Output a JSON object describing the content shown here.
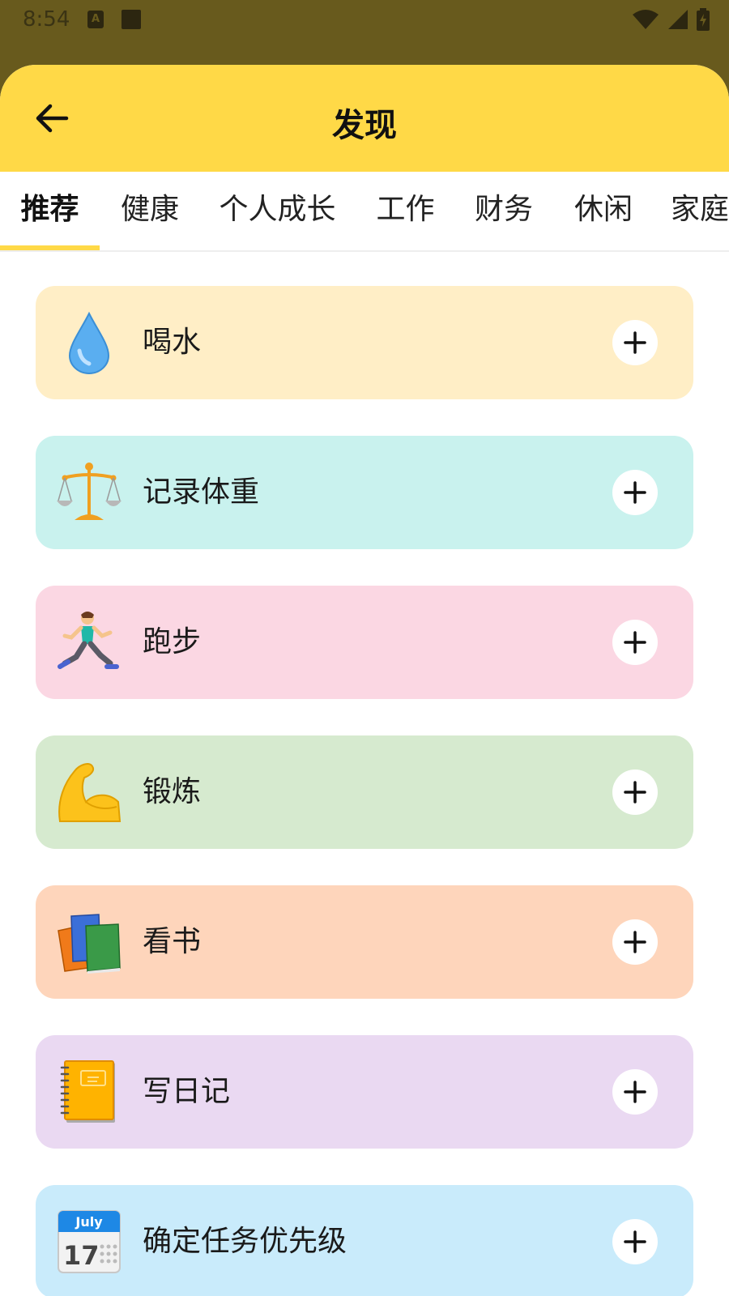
{
  "status_bar": {
    "time": "8:54",
    "notif_label": "A"
  },
  "header": {
    "title": "发现"
  },
  "tabs": [
    {
      "label": "推荐"
    },
    {
      "label": "健康"
    },
    {
      "label": "个人成长"
    },
    {
      "label": "工作"
    },
    {
      "label": "财务"
    },
    {
      "label": "休闲"
    },
    {
      "label": "家庭"
    }
  ],
  "items": [
    {
      "label": "喝水",
      "icon": "water-drop-icon",
      "bg": "#ffeec6"
    },
    {
      "label": "记录体重",
      "icon": "balance-scale-icon",
      "bg": "#c9f2ee"
    },
    {
      "label": "跑步",
      "icon": "runner-icon",
      "bg": "#fbd7e3"
    },
    {
      "label": "锻炼",
      "icon": "flexed-biceps-icon",
      "bg": "#d6eacf"
    },
    {
      "label": "看书",
      "icon": "books-icon",
      "bg": "#fed5bb"
    },
    {
      "label": "写日记",
      "icon": "notebook-icon",
      "bg": "#ead9f2"
    },
    {
      "label": "确定任务优先级",
      "icon": "calendar-icon",
      "bg": "#c9ebfb",
      "calendar_month": "July",
      "calendar_day": "17"
    }
  ]
}
